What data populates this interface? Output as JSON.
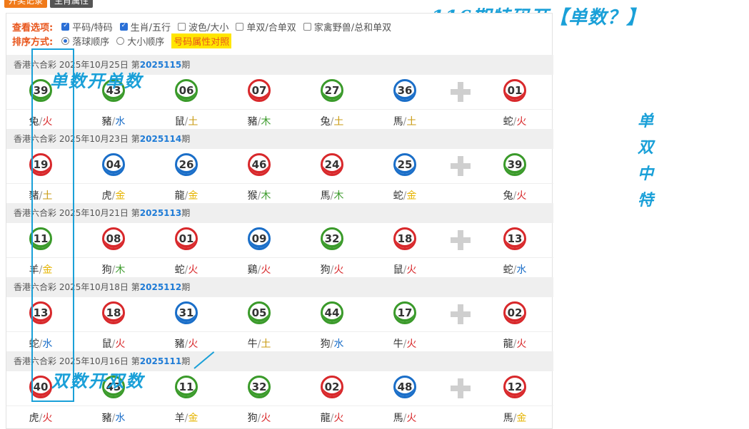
{
  "top_tabs": [
    "开奖记录",
    "生肖属性"
  ],
  "headline": "116期特码开【单数？】",
  "options": {
    "view_label": "查看选项:",
    "view_items": [
      {
        "label": "平码/特码",
        "checked": true
      },
      {
        "label": "生肖/五行",
        "checked": true
      },
      {
        "label": "波色/大小",
        "checked": false
      },
      {
        "label": "单双/合单双",
        "checked": false
      },
      {
        "label": "家禽野兽/总和单双",
        "checked": false
      }
    ],
    "sort_label": "排序方式:",
    "sort_items": [
      {
        "label": "落球顺序",
        "selected": true
      },
      {
        "label": "大小顺序",
        "selected": false
      }
    ],
    "attr_link": "号码属性对照"
  },
  "annotations": {
    "top": "单数开单数",
    "bottom": "双数开双数",
    "side": [
      "单",
      "双",
      "中",
      "特"
    ]
  },
  "colors": {
    "red": "#d8282b",
    "green": "#3a9a2a",
    "blue": "#1a6ec8",
    "accent": "#1aa0d8"
  },
  "draws": [
    {
      "lottery": "香港六合彩",
      "date": "2025年10月25日",
      "pre": "第",
      "issue": "2025115",
      "post": "期",
      "balls": [
        {
          "n": "39",
          "c": "green",
          "z": "兔",
          "e": "火",
          "ec": "fire"
        },
        {
          "n": "43",
          "c": "green",
          "z": "豬",
          "e": "水",
          "ec": "water"
        },
        {
          "n": "06",
          "c": "green",
          "z": "鼠",
          "e": "土",
          "ec": "earth"
        },
        {
          "n": "07",
          "c": "red",
          "z": "豬",
          "e": "木",
          "ec": "wood"
        },
        {
          "n": "27",
          "c": "green",
          "z": "兔",
          "e": "土",
          "ec": "earth"
        },
        {
          "n": "36",
          "c": "blue",
          "z": "馬",
          "e": "土",
          "ec": "earth"
        },
        {
          "n": "01",
          "c": "red",
          "z": "蛇",
          "e": "火",
          "ec": "fire"
        }
      ]
    },
    {
      "lottery": "香港六合彩",
      "date": "2025年10月23日",
      "pre": "第",
      "issue": "2025114",
      "post": "期",
      "balls": [
        {
          "n": "19",
          "c": "red",
          "z": "豬",
          "e": "土",
          "ec": "earth"
        },
        {
          "n": "04",
          "c": "blue",
          "z": "虎",
          "e": "金",
          "ec": "gold"
        },
        {
          "n": "26",
          "c": "blue",
          "z": "龍",
          "e": "金",
          "ec": "gold"
        },
        {
          "n": "46",
          "c": "red",
          "z": "猴",
          "e": "木",
          "ec": "wood"
        },
        {
          "n": "24",
          "c": "red",
          "z": "馬",
          "e": "木",
          "ec": "wood"
        },
        {
          "n": "25",
          "c": "blue",
          "z": "蛇",
          "e": "金",
          "ec": "gold"
        },
        {
          "n": "39",
          "c": "green",
          "z": "兔",
          "e": "火",
          "ec": "fire"
        }
      ]
    },
    {
      "lottery": "香港六合彩",
      "date": "2025年10月21日",
      "pre": "第",
      "issue": "2025113",
      "post": "期",
      "balls": [
        {
          "n": "11",
          "c": "green",
          "z": "羊",
          "e": "金",
          "ec": "gold"
        },
        {
          "n": "08",
          "c": "red",
          "z": "狗",
          "e": "木",
          "ec": "wood"
        },
        {
          "n": "01",
          "c": "red",
          "z": "蛇",
          "e": "火",
          "ec": "fire"
        },
        {
          "n": "09",
          "c": "blue",
          "z": "鷄",
          "e": "火",
          "ec": "fire"
        },
        {
          "n": "32",
          "c": "green",
          "z": "狗",
          "e": "火",
          "ec": "fire"
        },
        {
          "n": "18",
          "c": "red",
          "z": "鼠",
          "e": "火",
          "ec": "fire"
        },
        {
          "n": "13",
          "c": "red",
          "z": "蛇",
          "e": "水",
          "ec": "water"
        }
      ]
    },
    {
      "lottery": "香港六合彩",
      "date": "2025年10月18日",
      "pre": "第",
      "issue": "2025112",
      "post": "期",
      "balls": [
        {
          "n": "13",
          "c": "red",
          "z": "蛇",
          "e": "水",
          "ec": "water"
        },
        {
          "n": "18",
          "c": "red",
          "z": "鼠",
          "e": "火",
          "ec": "fire"
        },
        {
          "n": "31",
          "c": "blue",
          "z": "豬",
          "e": "火",
          "ec": "fire"
        },
        {
          "n": "05",
          "c": "green",
          "z": "牛",
          "e": "土",
          "ec": "earth"
        },
        {
          "n": "44",
          "c": "green",
          "z": "狗",
          "e": "水",
          "ec": "water"
        },
        {
          "n": "17",
          "c": "green",
          "z": "牛",
          "e": "火",
          "ec": "fire"
        },
        {
          "n": "02",
          "c": "red",
          "z": "龍",
          "e": "火",
          "ec": "fire"
        }
      ]
    },
    {
      "lottery": "香港六合彩",
      "date": "2025年10月16日",
      "pre": "第",
      "issue": "2025111",
      "post": "期",
      "balls": [
        {
          "n": "40",
          "c": "red",
          "z": "虎",
          "e": "火",
          "ec": "fire"
        },
        {
          "n": "43",
          "c": "green",
          "z": "豬",
          "e": "水",
          "ec": "water"
        },
        {
          "n": "11",
          "c": "green",
          "z": "羊",
          "e": "金",
          "ec": "gold"
        },
        {
          "n": "32",
          "c": "green",
          "z": "狗",
          "e": "火",
          "ec": "fire"
        },
        {
          "n": "02",
          "c": "red",
          "z": "龍",
          "e": "火",
          "ec": "fire"
        },
        {
          "n": "48",
          "c": "blue",
          "z": "馬",
          "e": "火",
          "ec": "fire"
        },
        {
          "n": "12",
          "c": "red",
          "z": "馬",
          "e": "金",
          "ec": "gold"
        }
      ]
    }
  ]
}
